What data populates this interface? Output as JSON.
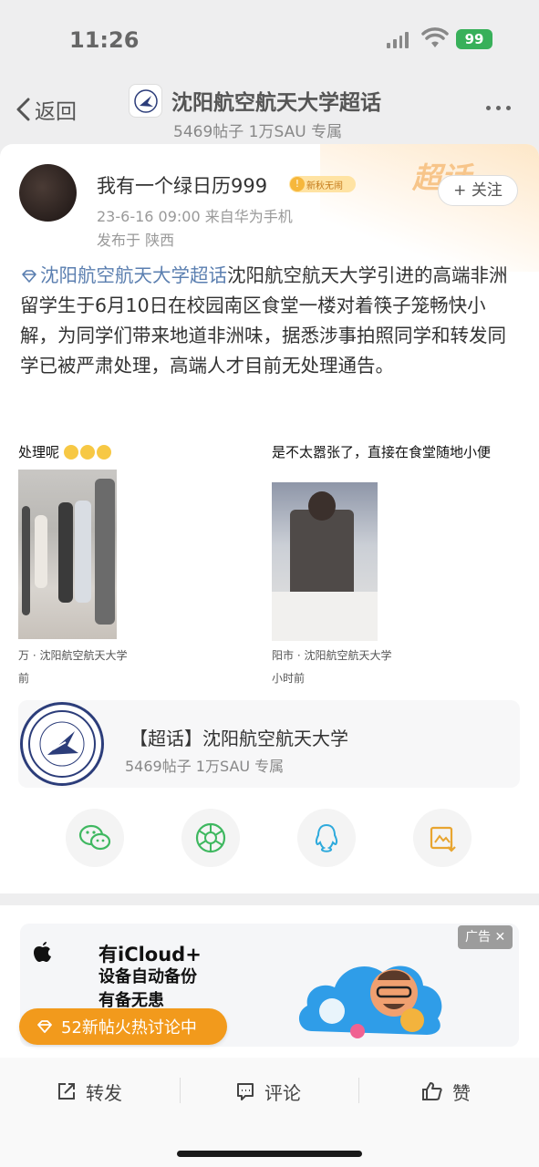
{
  "status_bar": {
    "time": "11:26",
    "battery": "99"
  },
  "nav": {
    "back_label": "返回",
    "title": "沈阳航空航天大学超话",
    "subtitle": "5469帖子 1万SAU 专属"
  },
  "post": {
    "author": "我有一个绿日历999",
    "badge": "新秋无闹",
    "follow_label": "+ 关注",
    "meta": "23-6-16 09:00  来自华为手机",
    "location": "发布于 陕西",
    "topic": "沈阳航空航天大学超话",
    "body": "沈阳航空航天大学引进的高端非洲留学生于6月10日在校园南区食堂一楼对着筷子笼畅快小解，为同学们带来地道非洲味，据悉涉事拍照同学和转发同学已被严肃处理，高端人才目前无处理通告。",
    "deco_text": "超话"
  },
  "images": {
    "left_caption": "处理呢",
    "right_caption": "是不太嚣张了，直接在食堂随地小便",
    "left_foot": "万 · 沈阳航空航天大学",
    "right_foot": "阳市 · 沈阳航空航天大学",
    "left_time": "前",
    "right_time": "小时前"
  },
  "topic_card": {
    "title": "【超话】沈阳航空航天大学",
    "subtitle": "5469帖子 1万SAU 专属"
  },
  "share": {
    "icons": [
      "wechat-icon",
      "moments-icon",
      "qq-icon",
      "save-image-icon"
    ]
  },
  "ad": {
    "line1": "有iCloud+",
    "line2": "设备自动备份",
    "line3": "有备无患",
    "tag": "广告 ✕"
  },
  "hot_pill": "52新帖火热讨论中",
  "bottom_bar": {
    "repost": "转发",
    "comment": "评论",
    "like": "赞"
  },
  "colors": {
    "link": "#5b7fb0",
    "hot": "#f29a1c",
    "battery": "#38b05a"
  }
}
